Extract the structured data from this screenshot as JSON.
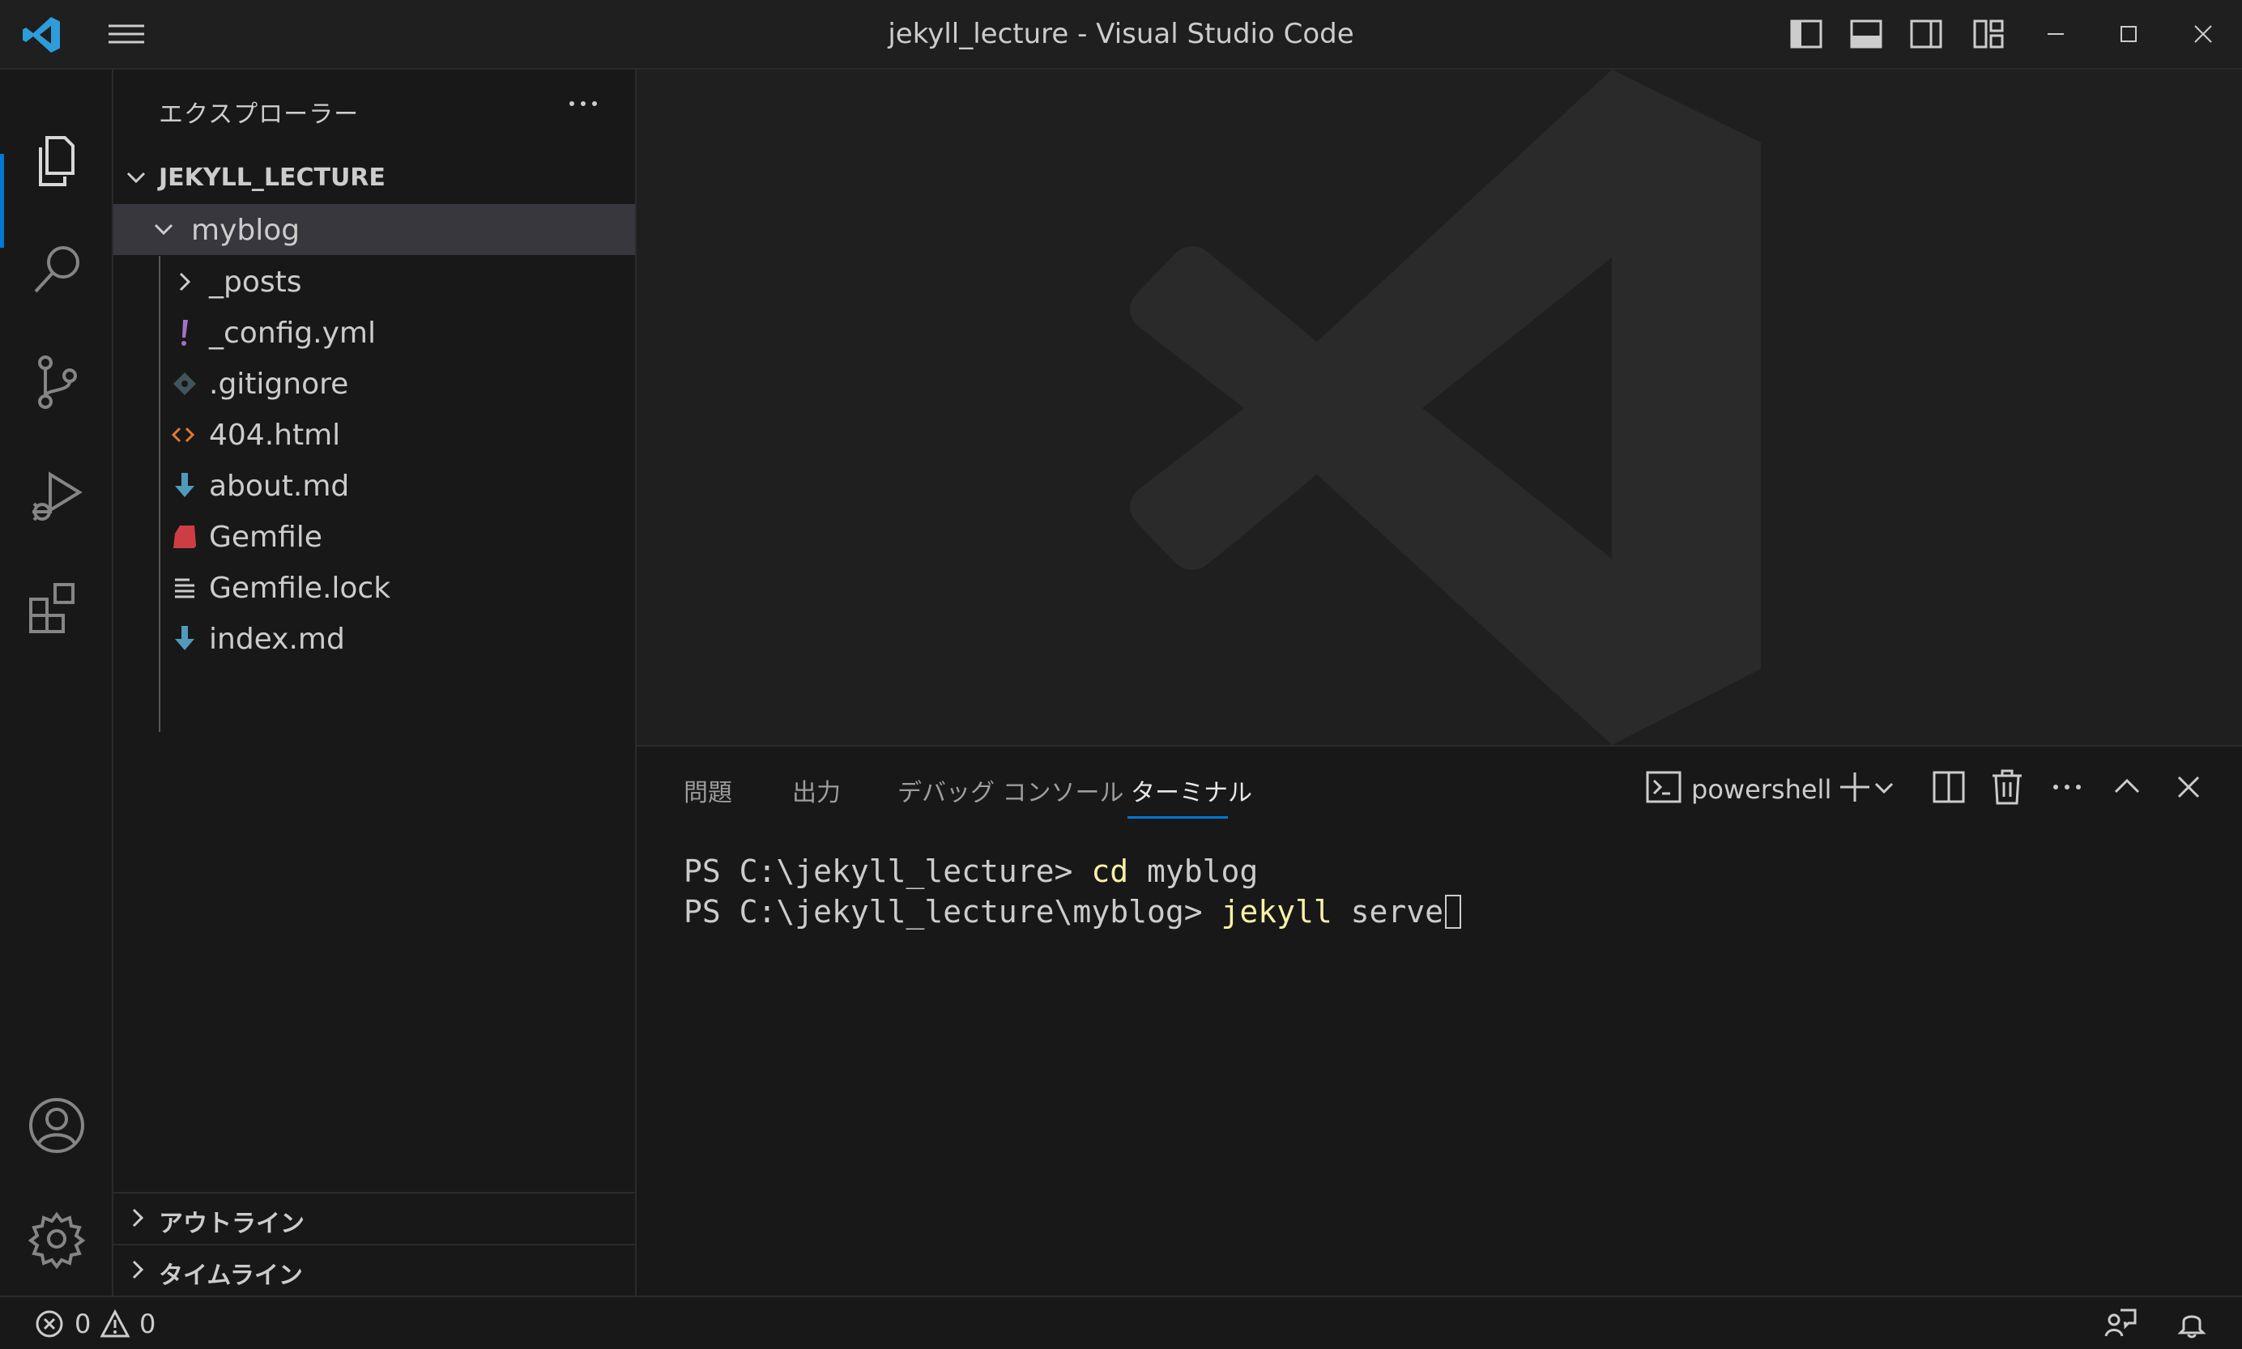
{
  "window": {
    "title": "jekyll_lecture - Visual Studio Code"
  },
  "sidebar": {
    "title": "エクスプローラー",
    "folder": "JEKYLL_LECTURE",
    "tree": [
      {
        "label": "myblog",
        "icon": "chevron-down-icon",
        "selected": true
      },
      {
        "label": "_posts",
        "icon": "chevron-right-icon"
      },
      {
        "label": "_config.yml",
        "icon": "yaml-file-icon",
        "icon_color": "#a074c4"
      },
      {
        "label": ".gitignore",
        "icon": "git-file-icon",
        "icon_color": "#41535b"
      },
      {
        "label": "404.html",
        "icon": "html-file-icon",
        "icon_color": "#e37933"
      },
      {
        "label": "about.md",
        "icon": "markdown-file-icon",
        "icon_color": "#519aba"
      },
      {
        "label": "Gemfile",
        "icon": "ruby-file-icon",
        "icon_color": "#cc3e44"
      },
      {
        "label": "Gemfile.lock",
        "icon": "text-file-icon",
        "icon_color": "#cccccc"
      },
      {
        "label": "index.md",
        "icon": "markdown-file-icon",
        "icon_color": "#519aba"
      }
    ],
    "sections": {
      "outline": "アウトライン",
      "timeline": "タイムライン"
    }
  },
  "panel": {
    "tabs": [
      {
        "label": "問題"
      },
      {
        "label": "出力"
      },
      {
        "label": "デバッグ コンソール"
      },
      {
        "label": "ターミナル",
        "active": true
      }
    ],
    "shell": "powershell",
    "terminal": {
      "line1_prompt": "PS C:\\jekyll_lecture> ",
      "line1_cmd": "cd",
      "line1_arg": " myblog",
      "line2_prompt": "PS C:\\jekyll_lecture\\myblog> ",
      "line2_cmd": "jekyll",
      "line2_arg": " serve"
    }
  },
  "statusbar": {
    "errors": "0",
    "warnings": "0"
  },
  "colors": {
    "accent": "#0078d4",
    "vscode_logo": "#2d9cdb",
    "terminal_command": "#f9f1a5"
  }
}
